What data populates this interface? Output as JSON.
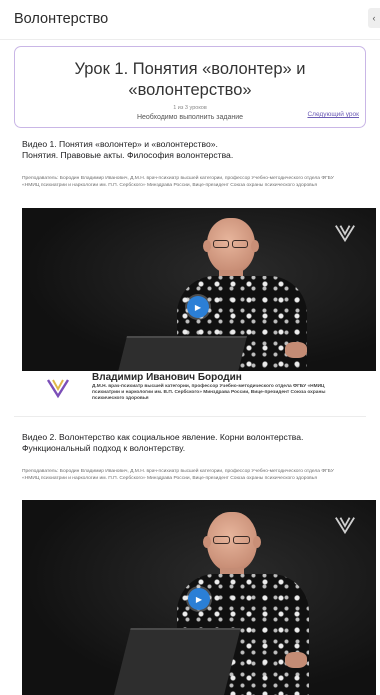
{
  "header": {
    "title": "Волонтерство",
    "collapse_icon": "chevron-left-icon"
  },
  "lesson": {
    "title": "Урок 1. Понятия «волонтер» и «волонтерство»",
    "progress": "1 из 3 уроков",
    "task": "Необходимо выполнить задание",
    "next_link": "Следующий урок"
  },
  "videos": [
    {
      "title_line1": "Видео 1. Понятия «волонтер» и «волонтерство».",
      "title_line2": "Понятия. Правовые акты. Философия волонтерства.",
      "meta": "Преподаватель: Бородин Владимир Иванович, Д.М.Н. врач-психиатр высшей категории, профессор Учебно-методического отдела ФГБУ «НМИЦ психиатрии и наркологии им. П.П. Сербского» Минздрава России, Вице-президент Союза охраны психического здоровья",
      "caption_name": "Владимир Иванович Бородин",
      "caption_desc": "Д.М.Н. врач-психиатр высшей категории, профессор Учебно-методического отдела ФГБУ «НМИЦ психиатрии и наркологии им. В.П. Сербского» Минздрава России, Вице-президент Союза охраны психического здоровья"
    },
    {
      "title_line1": "Видео 2. Волонтерство как социальное явление. Корни волонтерства.",
      "title_line2": "Функциональный подход к волонтерству.",
      "meta": "Преподаватель: Бородин Владимир Иванович, Д.М.Н. врач-психиатр высшей категории, профессор Учебно-методического отдела ФГБУ «НМИЦ психиатрии и наркологии им. П.П. Сербского» Минздрава России, Вице-президент Союза охраны психического здоровья"
    }
  ],
  "colors": {
    "accent": "#6b5bb5",
    "card_border": "#c9b6e6",
    "play": "#2b7fd6"
  }
}
